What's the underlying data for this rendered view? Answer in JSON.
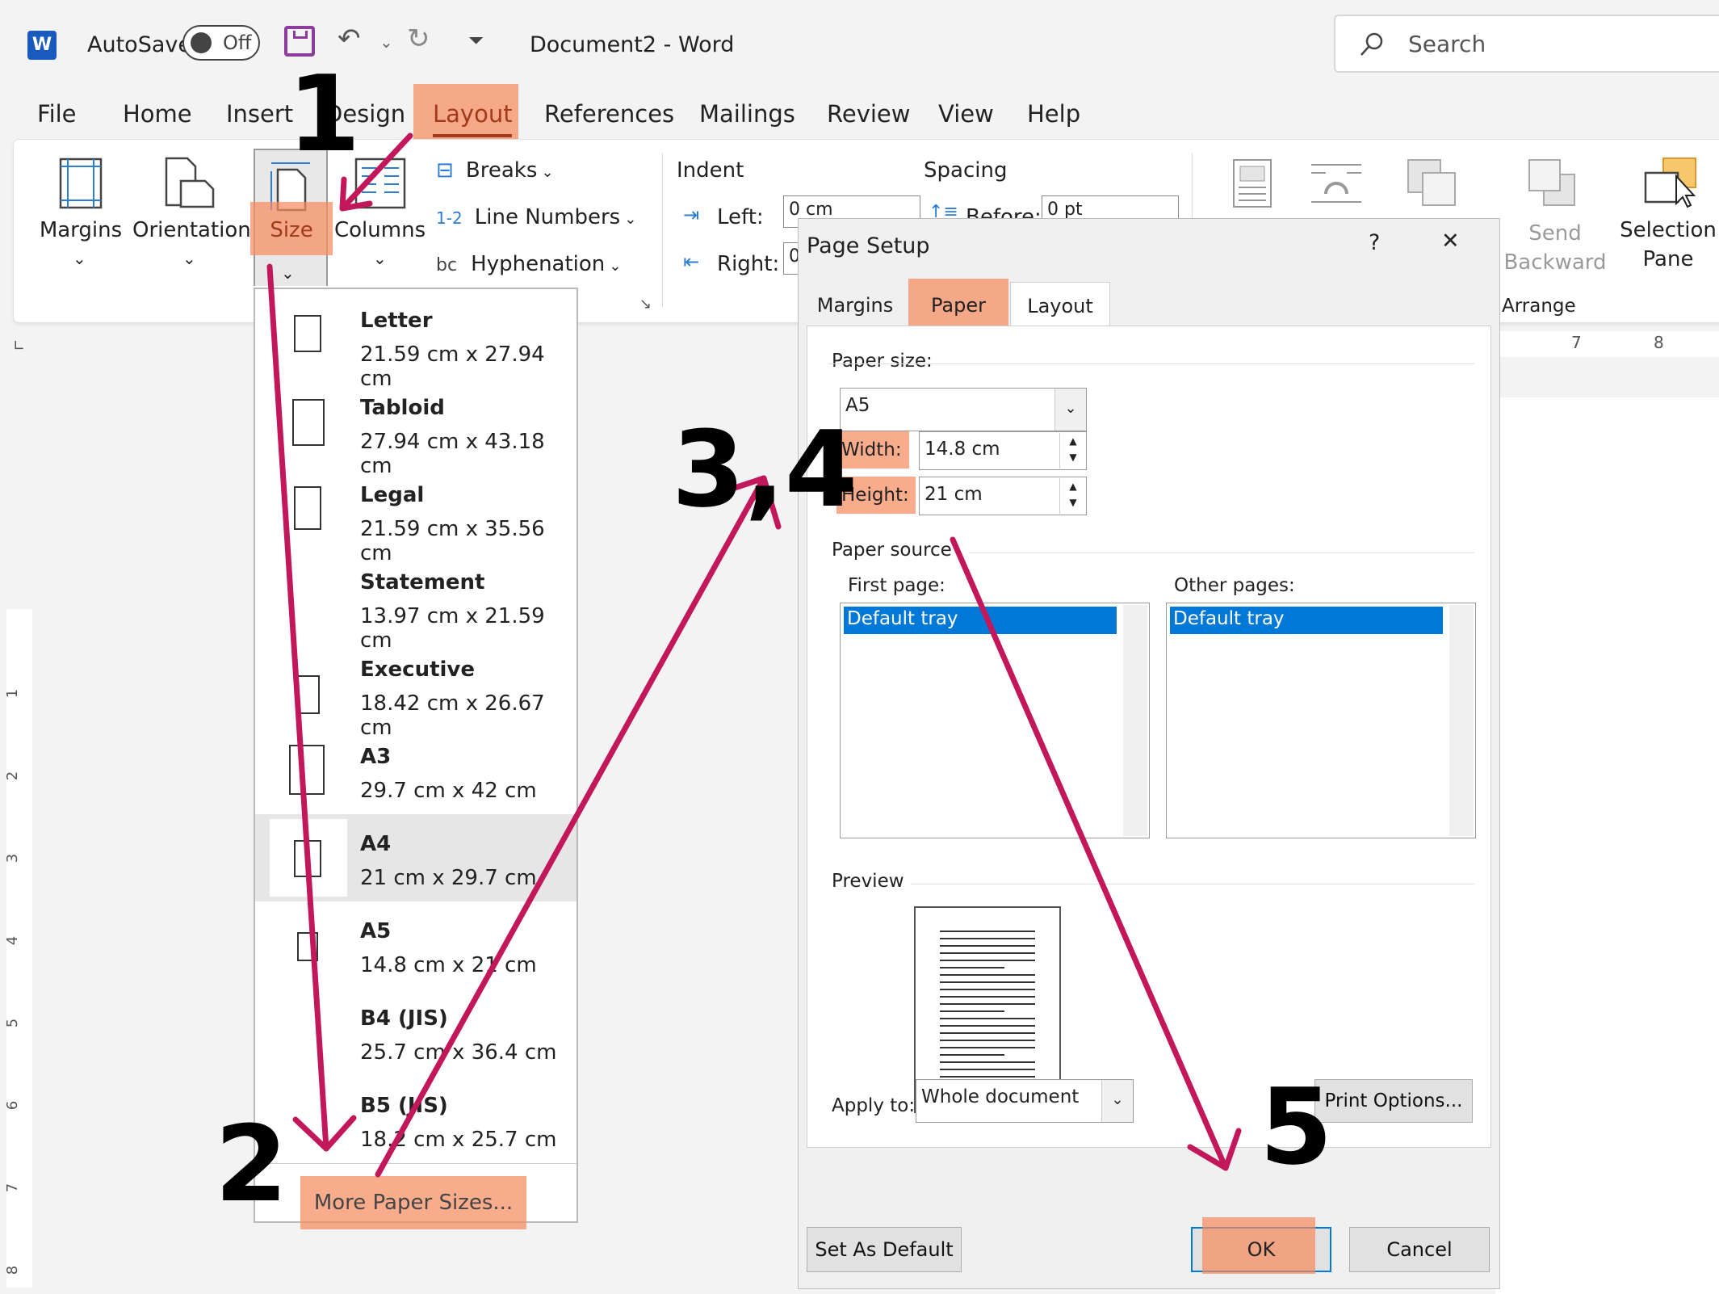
{
  "titlebar": {
    "autosave_label": "AutoSave",
    "toggle_state": "Off",
    "document_title": "Document2  -  Word",
    "search_placeholder": "Search"
  },
  "tabs": [
    "File",
    "Home",
    "Insert",
    "Design",
    "Layout",
    "References",
    "Mailings",
    "Review",
    "View",
    "Help"
  ],
  "ribbon": {
    "margins": "Margins",
    "orientation": "Orientation",
    "size": "Size",
    "columns": "Columns",
    "breaks": "Breaks",
    "line_numbers": "Line Numbers",
    "hyphenation": "Hyphenation",
    "indent": "Indent",
    "indent_left_label": "Left:",
    "indent_right_label": "Right:",
    "indent_left_value": "0 cm",
    "indent_right_value": "0",
    "spacing": "Spacing",
    "spacing_before_label": "Before:",
    "spacing_before_value": "0 pt",
    "send_backward_1": "Send",
    "send_backward_2": "Backward",
    "selection_pane_1": "Selection",
    "selection_pane_2": "Pane",
    "arrange": "Arrange",
    "ruler_7": "7",
    "ruler_8": "8"
  },
  "left_ruler": [
    "1",
    "2",
    "3",
    "4",
    "5",
    "6",
    "7",
    "8"
  ],
  "size_menu": {
    "items": [
      {
        "name": "Letter",
        "dims": "21.59 cm x 27.94 cm"
      },
      {
        "name": "Tabloid",
        "dims": "27.94 cm x 43.18 cm"
      },
      {
        "name": "Legal",
        "dims": "21.59 cm x 35.56 cm"
      },
      {
        "name": "Statement",
        "dims": "13.97 cm x 21.59 cm"
      },
      {
        "name": "Executive",
        "dims": "18.42 cm x 26.67 cm"
      },
      {
        "name": "A3",
        "dims": "29.7 cm x 42 cm"
      },
      {
        "name": "A4",
        "dims": "21 cm x 29.7 cm"
      },
      {
        "name": "A5",
        "dims": "14.8 cm x 21 cm"
      },
      {
        "name": "B4 (JIS)",
        "dims": "25.7 cm x 36.4 cm"
      },
      {
        "name": "B5 (JIS)",
        "dims": "18.2 cm x 25.7 cm"
      }
    ],
    "selected": "A4",
    "more": "More Paper Sizes..."
  },
  "dialog": {
    "title": "Page Setup",
    "help": "?",
    "close": "✕",
    "tabs": [
      "Margins",
      "Paper",
      "Layout"
    ],
    "active_tab": "Paper",
    "paper_size_label": "Paper size:",
    "paper_size_value": "A5",
    "width_label": "Width:",
    "width_value": "14.8 cm",
    "height_label": "Height:",
    "height_value": "21 cm",
    "paper_source": "Paper source",
    "first_page_label": "First page:",
    "other_pages_label": "Other pages:",
    "first_page_selected": "Default tray",
    "other_pages_selected": "Default tray",
    "preview_label": "Preview",
    "apply_to_label": "Apply to:",
    "apply_to_value": "Whole document",
    "print_options": "Print Options...",
    "set_default": "Set As Default",
    "ok": "OK",
    "cancel": "Cancel"
  },
  "annotations": {
    "step1": "1",
    "step2": "2",
    "step34": "3,4",
    "step5": "5",
    "highlight_color": "#f58c5f",
    "arrow_color": "#c2185b"
  }
}
